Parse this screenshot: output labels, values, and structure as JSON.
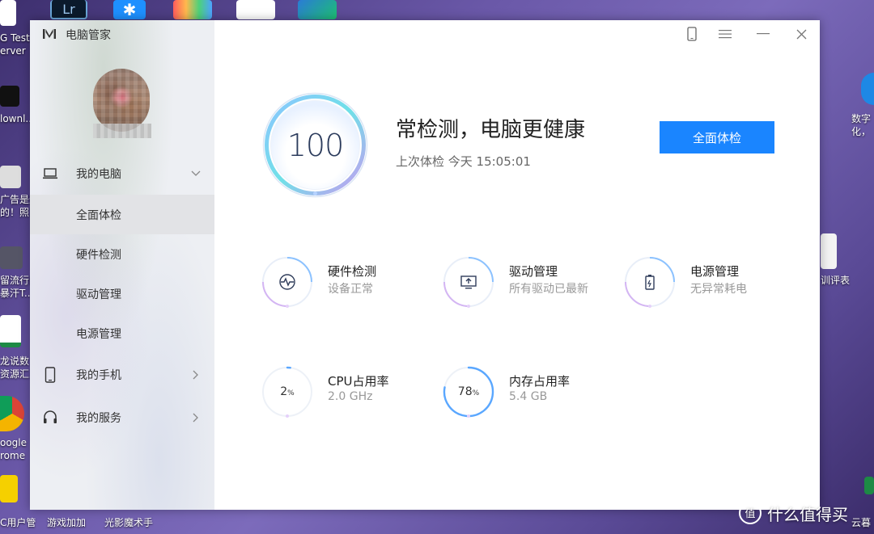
{
  "desktop": {
    "left_labels": [
      "G Test",
      "erver",
      "lownl..",
      "广告是这",
      "的！照..",
      "留流行的",
      "暴汗T..",
      "龙说数",
      "资源汇总",
      "oogle",
      "rome",
      "C用户管",
      "游戏加加",
      "光影魔术手"
    ],
    "right_labels": [
      "数字",
      "化，",
      "训评表",
      "云暮"
    ]
  },
  "app": {
    "title": "电脑管家"
  },
  "sidebar": {
    "items": [
      {
        "label": "我的电脑",
        "icon": "laptop-icon",
        "has_chevron": true,
        "chevron": "down"
      },
      {
        "label": "全面体检",
        "active": true
      },
      {
        "label": "硬件检测"
      },
      {
        "label": "驱动管理"
      },
      {
        "label": "电源管理"
      },
      {
        "label": "我的手机",
        "icon": "phone-icon",
        "has_chevron": true,
        "chevron": "right"
      },
      {
        "label": "我的服务",
        "icon": "headset-icon",
        "has_chevron": true,
        "chevron": "right"
      }
    ]
  },
  "main": {
    "score": "100",
    "headline": "常检测，电脑更健康",
    "last_check": "上次体检 今天 15:05:01",
    "check_button": "全面体检",
    "features": [
      {
        "title": "硬件检测",
        "subtitle": "设备正常",
        "icon": "hardware-pulse-icon"
      },
      {
        "title": "驱动管理",
        "subtitle": "所有驱动已最新",
        "icon": "driver-monitor-icon"
      },
      {
        "title": "电源管理",
        "subtitle": "无异常耗电",
        "icon": "battery-icon"
      }
    ],
    "usage": [
      {
        "title": "CPU占用率",
        "subtitle": "2.0 GHz",
        "value": "2",
        "unit": "%",
        "percent": 2
      },
      {
        "title": "内存占用率",
        "subtitle": "5.4 GB",
        "value": "78",
        "unit": "%",
        "percent": 78
      }
    ]
  },
  "watermark": {
    "text": "什么值得买"
  },
  "colors": {
    "accent": "#1a85ff",
    "ring_gradient_start": "#7fb8ff",
    "ring_gradient_end": "#c7a4ef"
  }
}
